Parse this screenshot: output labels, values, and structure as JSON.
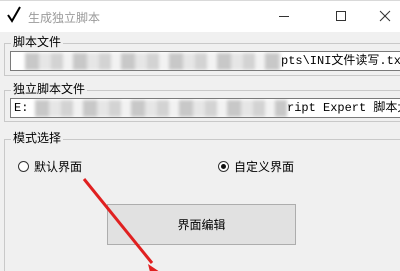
{
  "window": {
    "title": "生成独立脚本",
    "icon": "checkmark-icon",
    "controls": {
      "minimize": "minimize-icon",
      "maximize": "maximize-icon",
      "close": "close-icon"
    }
  },
  "script_file": {
    "label": "脚本文件",
    "value_start": "",
    "value_end": "pts\\INI文件读写.txt"
  },
  "standalone_script_file": {
    "label": "独立脚本文件",
    "value_start": "E:",
    "value_end": "ript Expert 脚本大"
  },
  "mode": {
    "label": "模式选择",
    "options": [
      {
        "label": "默认界面",
        "selected": false
      },
      {
        "label": "自定义界面",
        "selected": true
      }
    ],
    "edit_button_label": "界面编辑"
  },
  "colors": {
    "annotation_arrow": "#e02020"
  }
}
